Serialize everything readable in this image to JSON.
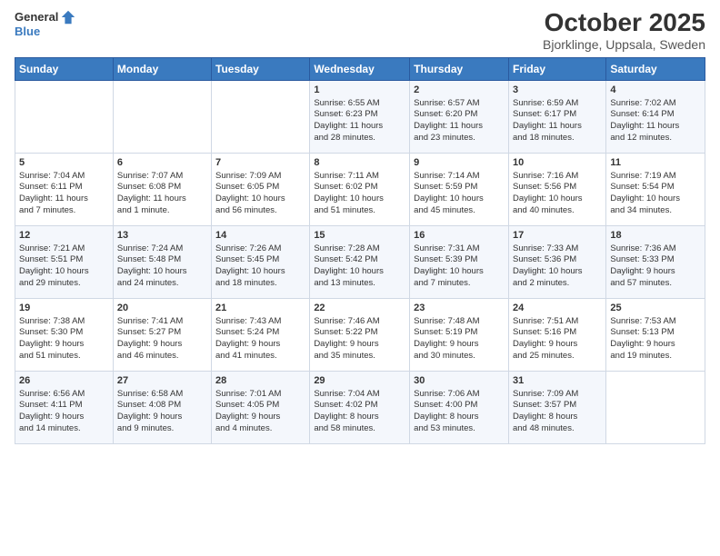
{
  "header": {
    "logo_general": "General",
    "logo_blue": "Blue",
    "month": "October 2025",
    "location": "Bjorklinge, Uppsala, Sweden"
  },
  "days_of_week": [
    "Sunday",
    "Monday",
    "Tuesday",
    "Wednesday",
    "Thursday",
    "Friday",
    "Saturday"
  ],
  "weeks": [
    [
      {
        "day": "",
        "info": ""
      },
      {
        "day": "",
        "info": ""
      },
      {
        "day": "",
        "info": ""
      },
      {
        "day": "1",
        "info": "Sunrise: 6:55 AM\nSunset: 6:23 PM\nDaylight: 11 hours\nand 28 minutes."
      },
      {
        "day": "2",
        "info": "Sunrise: 6:57 AM\nSunset: 6:20 PM\nDaylight: 11 hours\nand 23 minutes."
      },
      {
        "day": "3",
        "info": "Sunrise: 6:59 AM\nSunset: 6:17 PM\nDaylight: 11 hours\nand 18 minutes."
      },
      {
        "day": "4",
        "info": "Sunrise: 7:02 AM\nSunset: 6:14 PM\nDaylight: 11 hours\nand 12 minutes."
      }
    ],
    [
      {
        "day": "5",
        "info": "Sunrise: 7:04 AM\nSunset: 6:11 PM\nDaylight: 11 hours\nand 7 minutes."
      },
      {
        "day": "6",
        "info": "Sunrise: 7:07 AM\nSunset: 6:08 PM\nDaylight: 11 hours\nand 1 minute."
      },
      {
        "day": "7",
        "info": "Sunrise: 7:09 AM\nSunset: 6:05 PM\nDaylight: 10 hours\nand 56 minutes."
      },
      {
        "day": "8",
        "info": "Sunrise: 7:11 AM\nSunset: 6:02 PM\nDaylight: 10 hours\nand 51 minutes."
      },
      {
        "day": "9",
        "info": "Sunrise: 7:14 AM\nSunset: 5:59 PM\nDaylight: 10 hours\nand 45 minutes."
      },
      {
        "day": "10",
        "info": "Sunrise: 7:16 AM\nSunset: 5:56 PM\nDaylight: 10 hours\nand 40 minutes."
      },
      {
        "day": "11",
        "info": "Sunrise: 7:19 AM\nSunset: 5:54 PM\nDaylight: 10 hours\nand 34 minutes."
      }
    ],
    [
      {
        "day": "12",
        "info": "Sunrise: 7:21 AM\nSunset: 5:51 PM\nDaylight: 10 hours\nand 29 minutes."
      },
      {
        "day": "13",
        "info": "Sunrise: 7:24 AM\nSunset: 5:48 PM\nDaylight: 10 hours\nand 24 minutes."
      },
      {
        "day": "14",
        "info": "Sunrise: 7:26 AM\nSunset: 5:45 PM\nDaylight: 10 hours\nand 18 minutes."
      },
      {
        "day": "15",
        "info": "Sunrise: 7:28 AM\nSunset: 5:42 PM\nDaylight: 10 hours\nand 13 minutes."
      },
      {
        "day": "16",
        "info": "Sunrise: 7:31 AM\nSunset: 5:39 PM\nDaylight: 10 hours\nand 7 minutes."
      },
      {
        "day": "17",
        "info": "Sunrise: 7:33 AM\nSunset: 5:36 PM\nDaylight: 10 hours\nand 2 minutes."
      },
      {
        "day": "18",
        "info": "Sunrise: 7:36 AM\nSunset: 5:33 PM\nDaylight: 9 hours\nand 57 minutes."
      }
    ],
    [
      {
        "day": "19",
        "info": "Sunrise: 7:38 AM\nSunset: 5:30 PM\nDaylight: 9 hours\nand 51 minutes."
      },
      {
        "day": "20",
        "info": "Sunrise: 7:41 AM\nSunset: 5:27 PM\nDaylight: 9 hours\nand 46 minutes."
      },
      {
        "day": "21",
        "info": "Sunrise: 7:43 AM\nSunset: 5:24 PM\nDaylight: 9 hours\nand 41 minutes."
      },
      {
        "day": "22",
        "info": "Sunrise: 7:46 AM\nSunset: 5:22 PM\nDaylight: 9 hours\nand 35 minutes."
      },
      {
        "day": "23",
        "info": "Sunrise: 7:48 AM\nSunset: 5:19 PM\nDaylight: 9 hours\nand 30 minutes."
      },
      {
        "day": "24",
        "info": "Sunrise: 7:51 AM\nSunset: 5:16 PM\nDaylight: 9 hours\nand 25 minutes."
      },
      {
        "day": "25",
        "info": "Sunrise: 7:53 AM\nSunset: 5:13 PM\nDaylight: 9 hours\nand 19 minutes."
      }
    ],
    [
      {
        "day": "26",
        "info": "Sunrise: 6:56 AM\nSunset: 4:11 PM\nDaylight: 9 hours\nand 14 minutes."
      },
      {
        "day": "27",
        "info": "Sunrise: 6:58 AM\nSunset: 4:08 PM\nDaylight: 9 hours\nand 9 minutes."
      },
      {
        "day": "28",
        "info": "Sunrise: 7:01 AM\nSunset: 4:05 PM\nDaylight: 9 hours\nand 4 minutes."
      },
      {
        "day": "29",
        "info": "Sunrise: 7:04 AM\nSunset: 4:02 PM\nDaylight: 8 hours\nand 58 minutes."
      },
      {
        "day": "30",
        "info": "Sunrise: 7:06 AM\nSunset: 4:00 PM\nDaylight: 8 hours\nand 53 minutes."
      },
      {
        "day": "31",
        "info": "Sunrise: 7:09 AM\nSunset: 3:57 PM\nDaylight: 8 hours\nand 48 minutes."
      },
      {
        "day": "",
        "info": ""
      }
    ]
  ]
}
